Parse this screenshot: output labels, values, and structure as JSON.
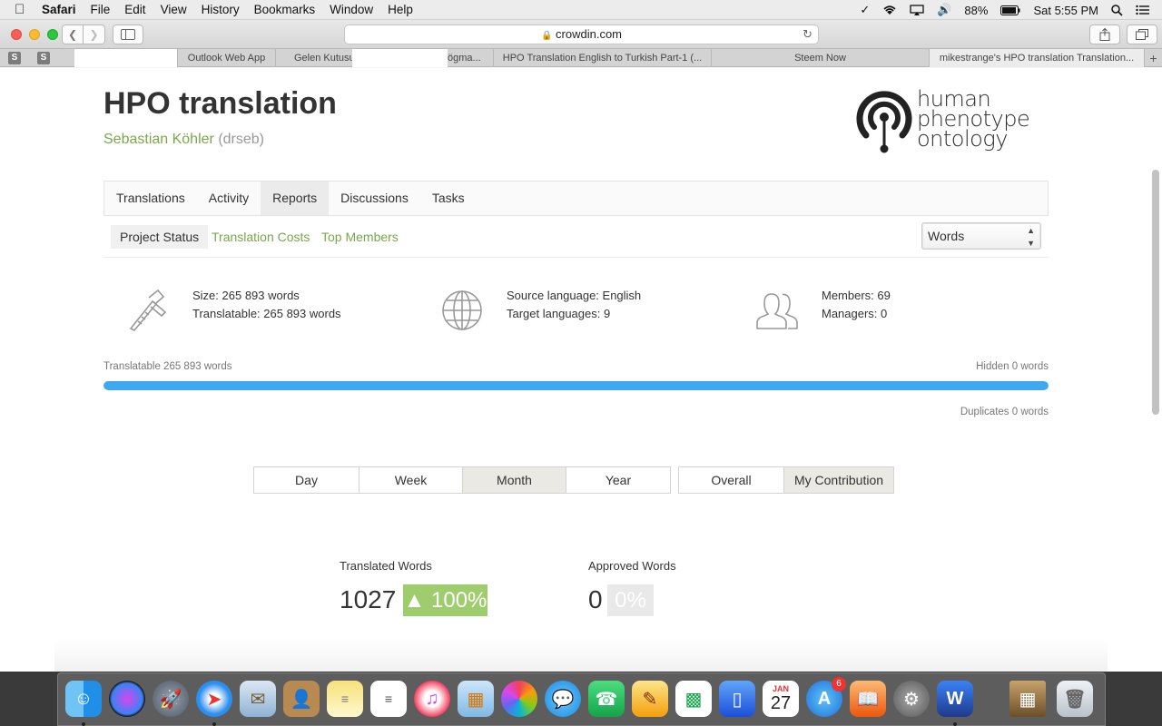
{
  "menubar": {
    "app": "Safari",
    "items": [
      "File",
      "Edit",
      "View",
      "History",
      "Bookmarks",
      "Window",
      "Help"
    ],
    "battery": "88%",
    "clock": "Sat 5:55 PM"
  },
  "browser": {
    "url": "crowdin.com",
    "pinned": [
      "S",
      "S"
    ],
    "tabs": [
      "Outlook Web App",
      "Gelen Kutusu",
      "ögma...",
      "HPO Translation English to Turkish Part-1 (...",
      "Steem Now",
      "mikestrange's HPO translation Translation..."
    ],
    "tab_add": "+"
  },
  "project": {
    "title": "HPO translation",
    "owner": "Sebastian Köhler",
    "owner_handle": "(drseb)",
    "logo_lines": [
      "human",
      "phenotype",
      "ontology"
    ]
  },
  "main_tabs": [
    "Translations",
    "Activity",
    "Reports",
    "Discussions",
    "Tasks"
  ],
  "sub_tabs": [
    "Project Status",
    "Translation Costs",
    "Top Members"
  ],
  "unit_select": "Words",
  "stats": {
    "size": "Size: 265 893 words",
    "translatable": "Translatable: 265 893 words",
    "source": "Source language: English",
    "targets": "Target languages: 9",
    "members": "Members: 69",
    "managers": "Managers: 0"
  },
  "progress": {
    "left_label": "Translatable 265 893 words",
    "right_label": "Hidden 0 words",
    "duplicates": "Duplicates 0 words",
    "fill_percent": 100
  },
  "periods": [
    "Day",
    "Week",
    "Month",
    "Year"
  ],
  "scopes": [
    "Overall",
    "My Contribution"
  ],
  "colors": {
    "accent_green": "#79a84a",
    "progress_blue": "#3ea9f0",
    "badge_green": "#9fcc6c"
  },
  "kpis": {
    "translated_label": "Translated Words",
    "translated_value": "1027",
    "translated_change": "▲ 100%",
    "approved_label": "Approved Words",
    "approved_value": "0",
    "approved_change": "0%"
  },
  "dock": {
    "calendar_month": "JAN",
    "calendar_day": "27",
    "appstore_badge": "6"
  }
}
